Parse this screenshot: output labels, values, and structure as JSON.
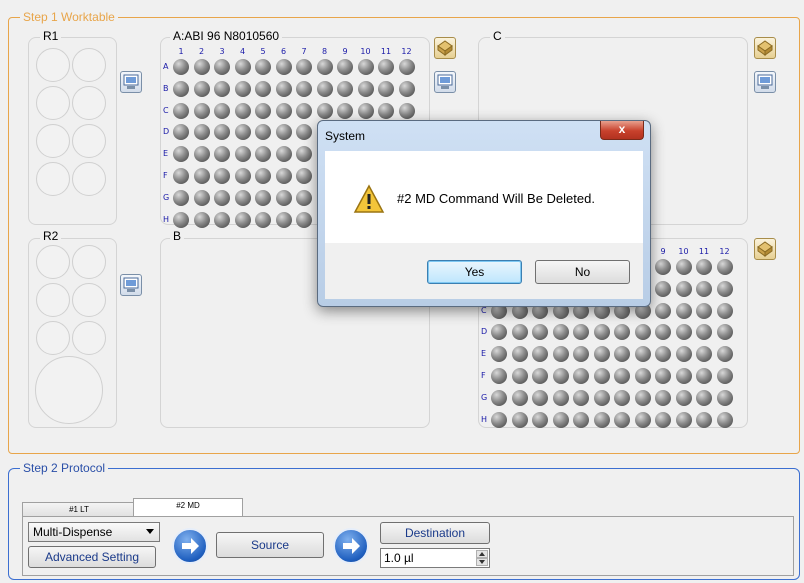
{
  "worktable": {
    "title": "Step 1 Worktable"
  },
  "panels": {
    "r1": "R1",
    "r2": "R2",
    "a": "A:ABI 96 N8010560",
    "b": "B",
    "c": "C"
  },
  "plate": {
    "rows": [
      "A",
      "B",
      "C",
      "D",
      "E",
      "F",
      "G",
      "H"
    ],
    "cols": [
      "1",
      "2",
      "3",
      "4",
      "5",
      "6",
      "7",
      "8",
      "9",
      "10",
      "11",
      "12"
    ],
    "well_color": "#6d6d6d",
    "label_color": "#1a1aa8"
  },
  "protocol": {
    "title": "Step 2 Protocol",
    "tabs": [
      {
        "label": "#1 LT"
      },
      {
        "label": "#2 MD"
      }
    ],
    "mode": "Multi-Dispense",
    "advanced_label": "Advanced Setting",
    "source_label": "Source",
    "destination_label": "Destination",
    "volume": "1.0 µl"
  },
  "dialog": {
    "title": "System",
    "close": "x",
    "message": "#2 MD Command Will Be Deleted.",
    "yes_label": "Yes",
    "no_label": "No",
    "icon": "warning-icon"
  },
  "colors": {
    "accent_orange": "#e8a54a",
    "protocol_border": "#3c6fd1",
    "close_red": "#c8412c"
  }
}
